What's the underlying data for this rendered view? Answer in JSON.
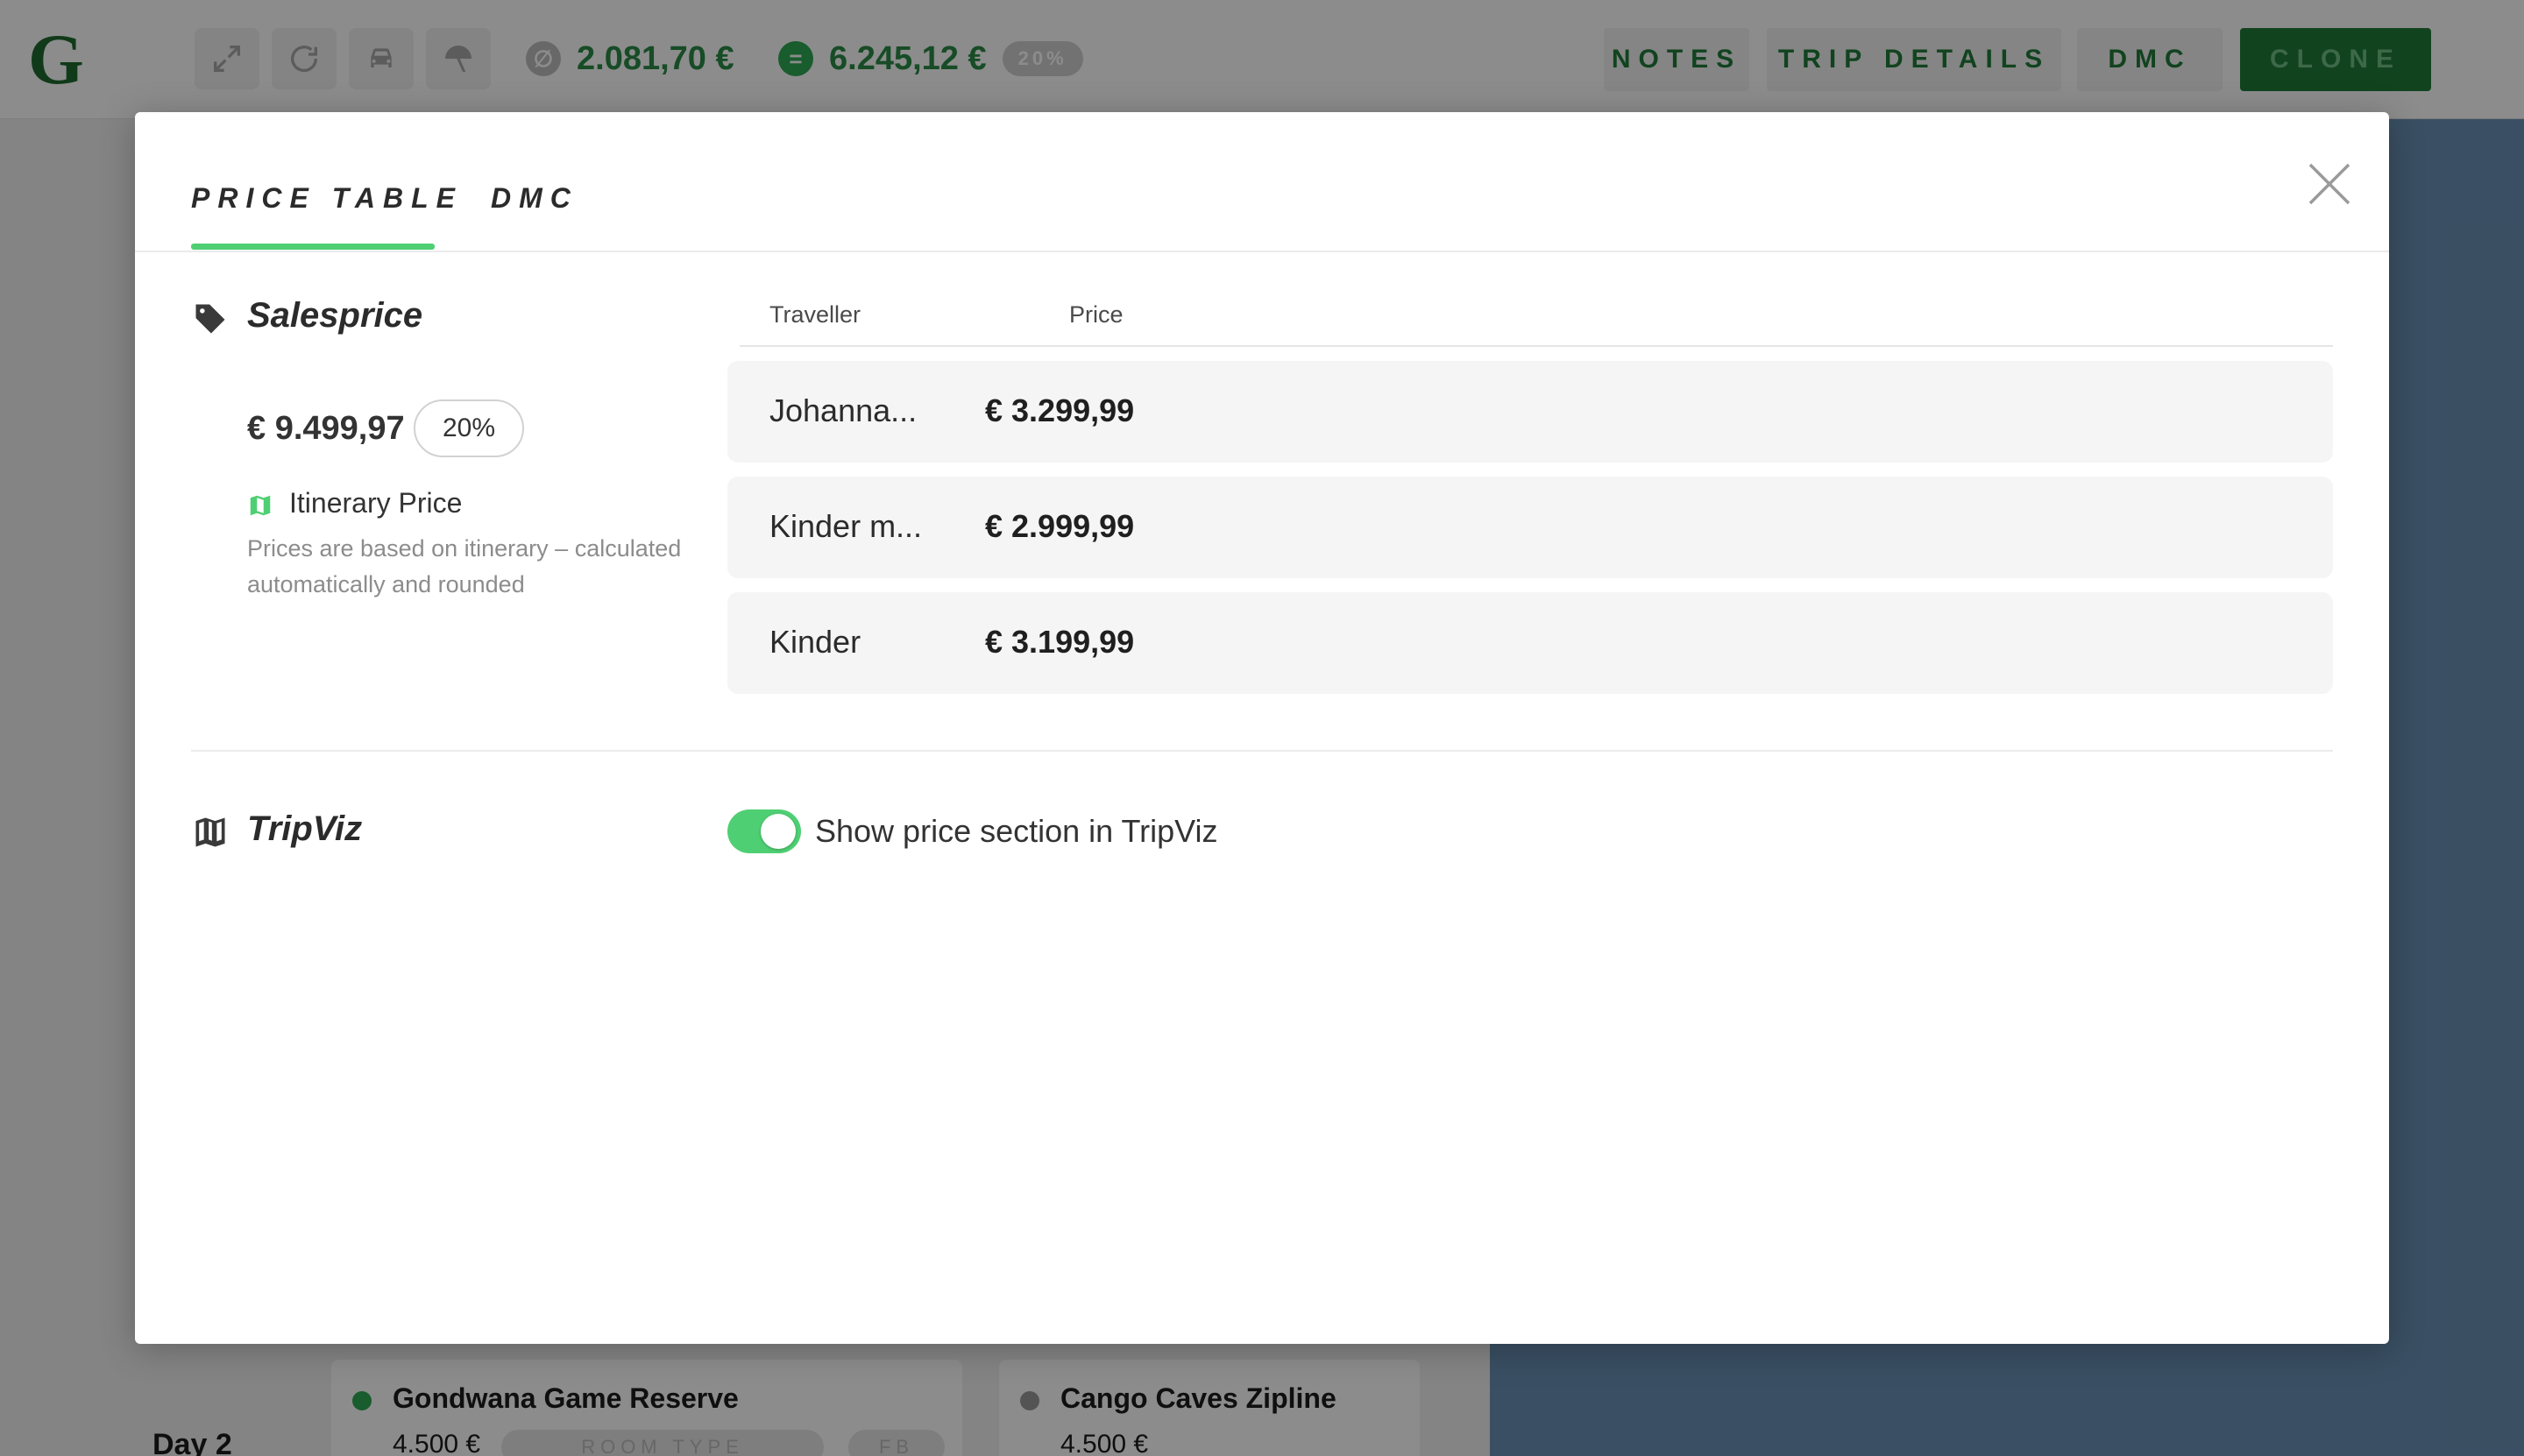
{
  "background": {
    "header": {
      "buttons": [
        "expand-icon",
        "refresh-icon",
        "car-icon",
        "beach-umbrella-icon"
      ],
      "cost_price": "2.081,70 €",
      "sales_price": "6.245,12 €",
      "margin_badge": "20%",
      "nav": {
        "notes": "NOTES",
        "trip_details": "TRIP DETAILS",
        "dmc": "DMC",
        "clone": "CLONE"
      }
    },
    "day_label": "Day 2",
    "cards": [
      {
        "title": "Gondwana Game Reserve",
        "price": "4.500 €",
        "tags": [
          "ROOM TYPE",
          "FB"
        ],
        "status_color": "#2fa852"
      },
      {
        "title": "Cango Caves Zipline",
        "price": "4.500 €",
        "status_color": "#9a9a9a"
      }
    ]
  },
  "modal": {
    "tabs": [
      {
        "label": "PRICE TABLE",
        "active": true
      },
      {
        "label": "DMC",
        "active": false
      }
    ],
    "salesprice": {
      "title": "Salesprice",
      "total": "€ 9.499,97",
      "margin": "20%",
      "itinerary_label": "Itinerary Price",
      "itinerary_desc": "Prices are based on itinerary – calculated automatically and rounded"
    },
    "table": {
      "columns": [
        "Traveller",
        "Price"
      ],
      "rows": [
        {
          "traveller": "Johanna...",
          "price": "€ 3.299,99"
        },
        {
          "traveller": "Kinder m...",
          "price": "€ 2.999,99"
        },
        {
          "traveller": "Kinder",
          "price": "€ 3.199,99"
        }
      ]
    },
    "tripviz": {
      "title": "TripViz",
      "toggle_on": true,
      "toggle_label": "Show price section in TripViz"
    }
  },
  "colors": {
    "accent": "#4fcf73",
    "brand_green": "#1f7a3a"
  }
}
